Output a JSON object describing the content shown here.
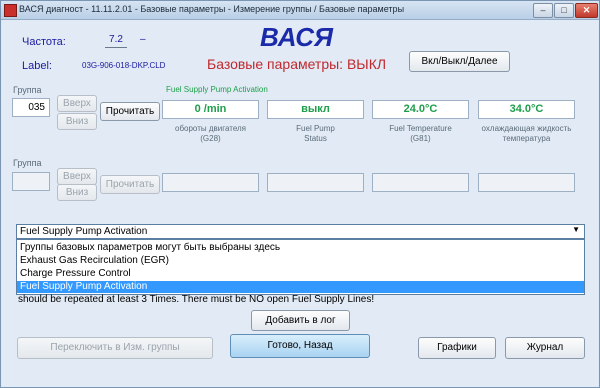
{
  "window": {
    "title": "ВАСЯ диагност - 11.11.2.01 - Базовые параметры - Измерение группы / Базовые параметры"
  },
  "header": {
    "app_name": "ВАСЯ",
    "frequency_label": "Частота:",
    "frequency_value": "7.2",
    "frequency_unit": "–",
    "label_label": "Label:",
    "label_value": "03G-906-018-DKP.CLD",
    "status_text": "Базовые параметры: ВЫКЛ",
    "toggle_button": "Вкл/Выкл/Далее"
  },
  "group1": {
    "label": "Группа",
    "value": "035",
    "up_button": "Вверх",
    "down_button": "Вниз",
    "read_button": "Прочитать",
    "test_name": "Fuel Supply Pump Activation",
    "fields": [
      {
        "value": "0 /min",
        "caption1": "обороты двигателя",
        "caption2": "(G28)"
      },
      {
        "value": "выкл",
        "caption1": "Fuel Pump",
        "caption2": "Status"
      },
      {
        "value": "24.0°C",
        "caption1": "Fuel Temperature",
        "caption2": "(G81)"
      },
      {
        "value": "34.0°C",
        "caption1": "охлаждающая жидкость",
        "caption2": "температура"
      }
    ]
  },
  "group2": {
    "label": "Группа",
    "value": "",
    "up_button": "Вверх",
    "down_button": "Вниз",
    "read_button": "Прочитать"
  },
  "dropdown": {
    "selected": "Fuel Supply Pump Activation",
    "options": [
      "Группы базовых параметров могут быть выбраны здесь",
      "Exhaust Gas Recirculation (EGR)",
      "Charge Pressure Control",
      "Fuel Supply Pump Activation"
    ]
  },
  "instruction_text": "should be repeated at least 3 Times. There must be NO open Fuel Supply Lines!",
  "buttons": {
    "add_log": "Добавить в лог",
    "switch_group": "Переключить в Изм. группы",
    "done_back": "Готово, Назад",
    "graphs": "Графики",
    "journal": "Журнал"
  }
}
